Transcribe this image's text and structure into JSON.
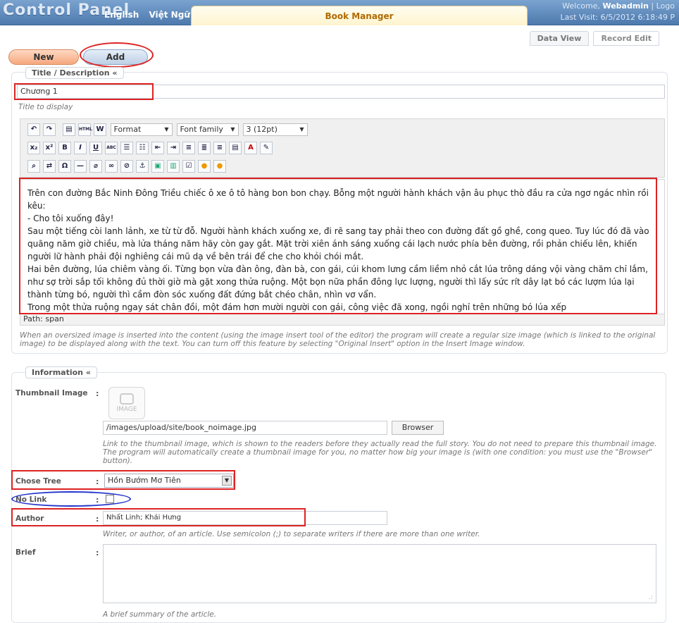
{
  "header": {
    "logo": "Control Panel",
    "lang_en": "English",
    "lang_vi": "Việt Ngữ",
    "tab_title": "Book Manager",
    "welcome": "Welcome, ",
    "username": "Webadmin",
    "logout": " | Logo",
    "last_visit": "Last Visit: 6/5/2012 6:18:49 P"
  },
  "view_tabs": [
    "Data View",
    "Record Edit"
  ],
  "buttons": {
    "new": "New",
    "add": "Add"
  },
  "title_section": {
    "legend": "Title / Description «",
    "title_value": "Chương 1",
    "title_hint": "Title to display"
  },
  "toolbar": {
    "format": "Format",
    "font_family": "Font family",
    "font_size": "3 (12pt)",
    "row1_icons": [
      "undo-icon",
      "redo-icon",
      "preview-icon",
      "html-icon",
      "paste-word-icon"
    ],
    "row1_glyphs": [
      "↶",
      "↷",
      "▤",
      "HTML",
      "W"
    ],
    "row2_glyphs": [
      "x₂",
      "x²",
      "B",
      "I",
      "U",
      "ABC",
      "☰",
      "☷",
      "⇤",
      "⇥",
      "≡",
      "≣",
      "≡",
      "▤",
      "A",
      "✎"
    ],
    "row3_glyphs": [
      "⌕",
      "⇄",
      "Ω",
      "—",
      "⌀",
      "∞",
      "⊘",
      "⚓",
      "▣",
      "▥",
      "☑",
      "●",
      "●"
    ]
  },
  "editor": {
    "paragraphs": [
      "Trên con đường Bắc Ninh Đông Triều chiếc ô xe ô tô hàng bon bon chạy. Bỗng một người hành khách vận âu phục thò đầu ra cửa ngơ ngác nhìn rồi kêu:",
      "- Cho tôi xuống đây!",
      "Sau một tiếng còi lanh lảnh, xe từ từ đỗ. Người hành khách xuống xe, đi rẽ sang tay phải theo con đường đất gồ ghề, cong queo. Tuy lúc đó đã vào quãng năm giờ chiều, mà lửa tháng năm hãy còn gay gắt. Mặt trời xiên ánh sáng xuống cái lạch nước phía bên đường, rồi phản chiếu lên, khiến người lữ hành phải đội nghiêng cái mũ dạ về bên trái để che cho khỏi chói mắt.",
      "Hai bên đường, lúa chiêm vàng ối. Từng bọn vừa đàn ông, đàn bà, con gái, cúi khom lưng cầm liềm nhỏ cắt lúa trông dáng vội vàng chăm chỉ lắm, như sợ trời sắp tối không đủ thời giờ mà gặt xong thửa ruộng. Một bọn nữa phần đông lực lượng, người thì lấy sức rít dây lạt bó các lượm lúa lại thành từng bó, người thì cầm đòn sóc xuống đất đứng bắt chéo chân, nhìn vơ vẩn.",
      "Trong một thửa ruộng ngay sát chân đồi, một đám hơn mười người con gái, công việc đã xong, ngồi nghỉ trên những bó lúa xếp"
    ],
    "path": "Path: span",
    "note": "When an oversized image is inserted into the content (using the image insert tool of the editor) the program will create a regular size image (which is linked to the original image) to be displayed along with the text. You can turn off this feature by selecting \"Original Insert\" option in the Insert Image window."
  },
  "info_section": {
    "legend": "Information «",
    "thumbnail_label": "Thumbnail Image",
    "thumbnail_placeholder": "IMAGE",
    "thumbnail_path": "/images/upload/site/book_noimage.jpg",
    "browser_button": "Browser",
    "thumbnail_hint": "Link to the thumbnail image, which is shown to the readers before they actually read the full story. You do not need to prepare this thumbnail image. The program will automatically create a thumbnail image for you, no matter how big your image is (with one condition: you must use the \"Browser\" button).",
    "tree_label": "Chose Tree",
    "tree_value": "Hồn Bướm Mơ Tiên",
    "nolink_label": "No Link",
    "author_label": "Author",
    "author_value": "Nhất Linh; Khái Hưng",
    "author_hint": "Writer, or author, of an article. Use semicolon (;) to separate writers if there are more than one writer.",
    "brief_label": "Brief",
    "brief_hint": "A brief summary of the article.",
    "colon": ":"
  },
  "colors": {
    "accent_blue": "#4d79ad",
    "tab_title": "#b06a00",
    "annotation_red": "#dd2222",
    "annotation_blue": "#2233cc"
  }
}
